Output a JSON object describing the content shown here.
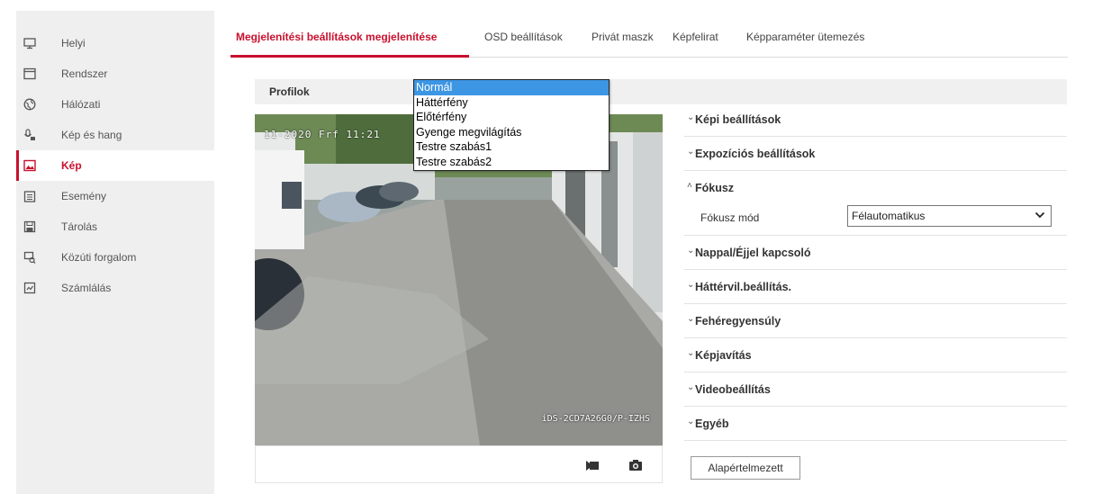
{
  "sidebar": {
    "items": [
      {
        "label": "Helyi",
        "icon": "monitor-icon"
      },
      {
        "label": "Rendszer",
        "icon": "system-window-icon"
      },
      {
        "label": "Hálózati",
        "icon": "network-globe-icon"
      },
      {
        "label": "Kép és hang",
        "icon": "audio-video-icon"
      },
      {
        "label": "Kép",
        "icon": "image-icon",
        "active": true
      },
      {
        "label": "Esemény",
        "icon": "event-calendar-icon"
      },
      {
        "label": "Tárolás",
        "icon": "storage-icon"
      },
      {
        "label": "Közúti forgalom",
        "icon": "traffic-icon"
      },
      {
        "label": "Számlálás",
        "icon": "counting-icon"
      }
    ]
  },
  "tabs": [
    {
      "label": "Megjelenítési beállítások megjelenítése",
      "active": true
    },
    {
      "label": "OSD beállítások"
    },
    {
      "label": "Privát maszk"
    },
    {
      "label": "Képfelirat"
    },
    {
      "label": "Képparaméter ütemezés"
    }
  ],
  "profile": {
    "label": "Profilok",
    "options": [
      "Normál",
      "Háttérfény",
      "Előtérfény",
      "Gyenge megvilágítás",
      "Testre szabás1",
      "Testre szabás2"
    ],
    "selected": "Normál"
  },
  "video": {
    "overlay_date": "11-2020 Frf 11:21",
    "overlay_camera": "iDS-2CD7A26G0/P-IZHS",
    "buttons": [
      "record-icon",
      "camera-icon"
    ]
  },
  "sections": [
    {
      "title": "Képi beállítások",
      "expanded": false
    },
    {
      "title": "Expozíciós beállítások",
      "expanded": false
    },
    {
      "title": "Fókusz",
      "expanded": true
    },
    {
      "title": "Nappal/Éjjel kapcsoló",
      "expanded": false
    },
    {
      "title": "Háttérvil.beállítás.",
      "expanded": false
    },
    {
      "title": "Fehéregyensúly",
      "expanded": false
    },
    {
      "title": "Képjavítás",
      "expanded": false
    },
    {
      "title": "Videobeállítás",
      "expanded": false
    },
    {
      "title": "Egyéb",
      "expanded": false
    }
  ],
  "focus": {
    "mode_label": "Fókusz mód",
    "mode_value": "Félautomatikus"
  },
  "default_button": "Alapértelmezett",
  "colors": {
    "accent": "#c8102e",
    "selection": "#3d96e3"
  }
}
